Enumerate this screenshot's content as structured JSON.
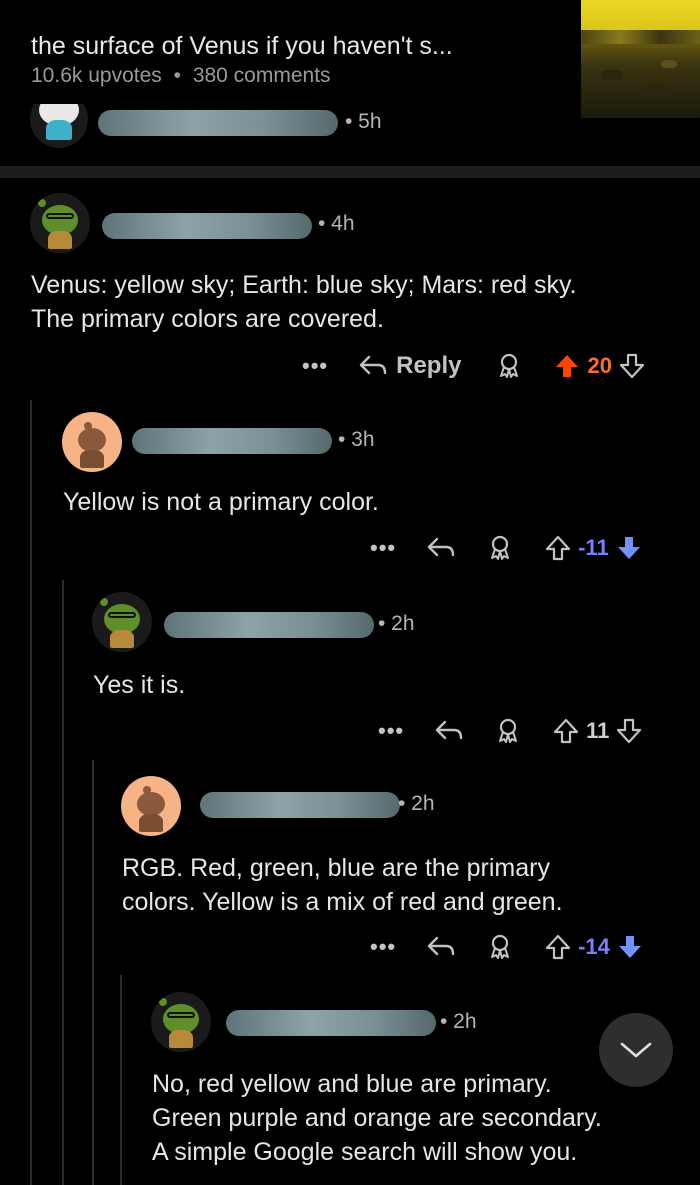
{
  "post": {
    "title": "the surface of Venus if you haven't s...",
    "upvotes": "10.6k upvotes",
    "separator": "•",
    "comments": "380 comments"
  },
  "previous_comment": {
    "time": "• 5h"
  },
  "comments": [
    {
      "time": "• 4h",
      "text": [
        "Venus: yellow sky;  Earth: blue sky; Mars: red sky.",
        "The primary colors are covered."
      ],
      "more": "•••",
      "reply": "Reply",
      "score": "20",
      "vote": "upvoted"
    },
    {
      "time": "• 3h",
      "text": [
        "Yellow is not a primary color."
      ],
      "more": "•••",
      "score": "-11",
      "vote": "downvoted"
    },
    {
      "time": "• 2h",
      "text": [
        "Yes it is."
      ],
      "more": "•••",
      "score": "11",
      "vote": "none"
    },
    {
      "time": "• 2h",
      "text": [
        "RGB. Red, green, blue are the primary",
        "colors. Yellow is a mix of red and green."
      ],
      "more": "•••",
      "score": "-14",
      "vote": "downvoted"
    },
    {
      "time": "• 2h",
      "text": [
        "No, red yellow and blue are primary.",
        "Green purple and orange are secondary.",
        "A simple Google search will show you."
      ]
    }
  ],
  "colors": {
    "upvote": "#ff4500",
    "downvote": "#7193ff",
    "background": "#000000"
  },
  "icons": [
    "reply-arrow-icon",
    "award-icon",
    "upvote-arrow-icon",
    "downvote-arrow-icon",
    "more-dots-icon",
    "chevron-down-icon"
  ]
}
